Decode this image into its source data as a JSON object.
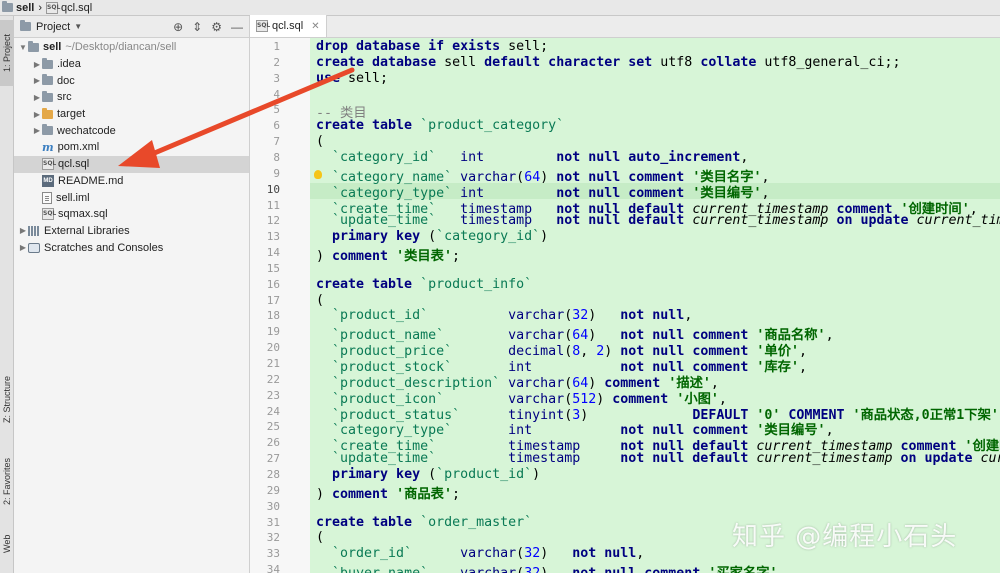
{
  "breadcrumb": {
    "project": "sell",
    "file": "qcl.sql"
  },
  "sidebar_tabs": {
    "project": "1: Project",
    "structure": "Z: Structure",
    "favorites": "2: Favorites",
    "web": "Web"
  },
  "project_panel": {
    "title": "Project",
    "root": {
      "name": "sell",
      "path": "~/Desktop/diancan/sell"
    },
    "items": [
      {
        "name": ".idea",
        "type": "folder"
      },
      {
        "name": "doc",
        "type": "folder"
      },
      {
        "name": "src",
        "type": "folder"
      },
      {
        "name": "target",
        "type": "folder-orange"
      },
      {
        "name": "wechatcode",
        "type": "folder"
      },
      {
        "name": "pom.xml",
        "type": "maven"
      },
      {
        "name": "qcl.sql",
        "type": "sql",
        "selected": true
      },
      {
        "name": "README.md",
        "type": "md"
      },
      {
        "name": "sell.iml",
        "type": "iml"
      },
      {
        "name": "sqmax.sql",
        "type": "sql"
      }
    ],
    "external_libraries": "External Libraries",
    "scratches": "Scratches and Consoles"
  },
  "editor": {
    "tab": "qcl.sql",
    "lines": [
      "<span class='kw'>drop database if exists</span> sell;",
      "<span class='kw'>create database</span> sell <span class='kw'>default character set</span> utf8 <span class='kw'>collate</span> utf8_general_ci;;",
      "<span class='kw'>use</span> sell;",
      "",
      "<span class='cm'>-- 类目</span>",
      "<span class='kw'>create table</span> <span class='id'>`product_category`</span>",
      "(",
      "  <span class='id'>`category_id`</span>   <span class='tp'>int</span>         <span class='kw'>not null auto_increment</span>,",
      "  <span class='id'>`category_name`</span> <span class='tp'>varchar</span>(<span class='num'>64</span>) <span class='kw'>not null comment</span> <span class='str'>'类目名字'</span>,",
      "  <span class='id'>`category_type`</span> <span class='tp'>int</span>         <span class='kw'>not null comment</span> <span class='str'>'类目编号'</span>,",
      "  <span class='id'>`create_time`</span>   <span class='tp'>timestamp</span>   <span class='kw'>not null default</span> <span class='fn'>current_timestamp</span> <span class='kw'>comment</span> <span class='str'>'创建时间'</span>,",
      "  <span class='id'>`update_time`</span>   <span class='tp'>timestamp</span>   <span class='kw'>not null default</span> <span class='fn'>current_timestamp</span> <span class='kw'>on update</span> <span class='fn'>current_timestamp</span>",
      "  <span class='kw'>primary key</span> (<span class='id'>`category_id`</span>)",
      ") <span class='kw'>comment</span> <span class='str'>'类目表'</span>;",
      "",
      "<span class='kw'>create table</span> <span class='id'>`product_info`</span>",
      "(",
      "  <span class='id'>`product_id`</span>          <span class='tp'>varchar</span>(<span class='num'>32</span>)   <span class='kw'>not null</span>,",
      "  <span class='id'>`product_name`</span>        <span class='tp'>varchar</span>(<span class='num'>64</span>)   <span class='kw'>not null comment</span> <span class='str'>'商品名称'</span>,",
      "  <span class='id'>`product_price`</span>       <span class='tp'>decimal</span>(<span class='num'>8</span>, <span class='num'>2</span>) <span class='kw'>not null comment</span> <span class='str'>'单价'</span>,",
      "  <span class='id'>`product_stock`</span>       <span class='tp'>int</span>           <span class='kw'>not null comment</span> <span class='str'>'库存'</span>,",
      "  <span class='id'>`product_description`</span> <span class='tp'>varchar</span>(<span class='num'>64</span>) <span class='kw'>comment</span> <span class='str'>'描述'</span>,",
      "  <span class='id'>`product_icon`</span>        <span class='tp'>varchar</span>(<span class='num'>512</span>) <span class='kw'>comment</span> <span class='str'>'小图'</span>,",
      "  <span class='id'>`product_status`</span>      <span class='tp'>tinyint</span>(<span class='num'>3</span>)             <span class='kw'>DEFAULT</span> <span class='str'>'0'</span> <span class='kw'>COMMENT</span> <span class='str'>'商品状态,0正常1下架'</span>,",
      "  <span class='id'>`category_type`</span>       <span class='tp'>int</span>           <span class='kw'>not null comment</span> <span class='str'>'类目编号'</span>,",
      "  <span class='id'>`create_time`</span>         <span class='tp'>timestamp</span>     <span class='kw'>not null default</span> <span class='fn'>current_timestamp</span> <span class='kw'>comment</span> <span class='str'>'创建时间'</span>,",
      "  <span class='id'>`update_time`</span>         <span class='tp'>timestamp</span>     <span class='kw'>not null default</span> <span class='fn'>current_timestamp</span> <span class='kw'>on update</span> <span class='fn'>current_timestamp</span>",
      "  <span class='kw'>primary key</span> (<span class='id'>`product_id`</span>)",
      ") <span class='kw'>comment</span> <span class='str'>'商品表'</span>;",
      "",
      "<span class='kw'>create table</span> <span class='id'>`order_master`</span>",
      "(",
      "  <span class='id'>`order_id`</span>      <span class='tp'>varchar</span>(<span class='num'>32</span>)   <span class='kw'>not null</span>,",
      "  <span class='id'>`buyer_name`</span>    <span class='tp'>varchar</span>(<span class='num'>32</span>)   <span class='kw'>not null comment</span> <span class='str'>'买家名字'</span>,"
    ],
    "line_numbers": [
      "1",
      "2",
      "3",
      "4",
      "5",
      "6",
      "7",
      "8",
      "9",
      "10",
      "11",
      "12",
      "13",
      "14",
      "15",
      "16",
      "17",
      "18",
      "19",
      "20",
      "21",
      "22",
      "23",
      "24",
      "25",
      "26",
      "27",
      "28",
      "29",
      "30",
      "31",
      "32",
      "33",
      "34"
    ]
  },
  "watermark": "知乎 @编程小石头",
  "colors": {
    "code_background": "#d7f5d7",
    "arrow": "#e8492a"
  }
}
